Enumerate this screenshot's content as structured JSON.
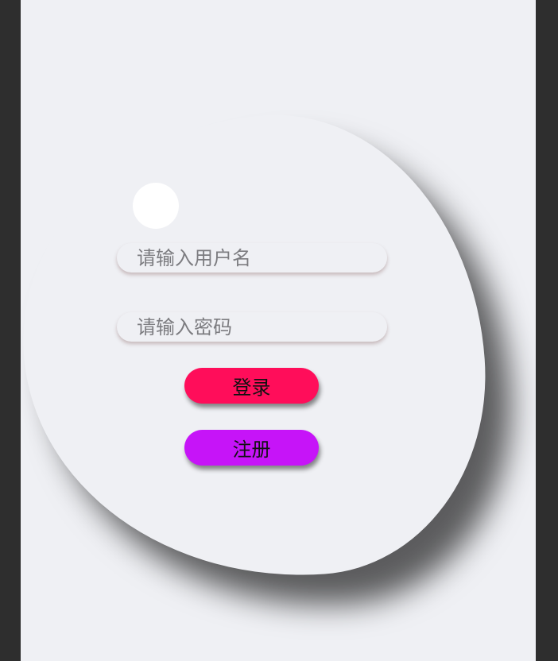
{
  "login_form": {
    "username_placeholder": "请输入用户名",
    "username_value": "",
    "password_placeholder": "请输入密码",
    "password_value": "",
    "login_label": "登录",
    "register_label": "注册"
  },
  "colors": {
    "page_background": "#eff0f4",
    "frame": "#2e2e2e",
    "login_button": "#ff0d5a",
    "register_button": "#c614f8",
    "avatar": "#ffffff"
  }
}
